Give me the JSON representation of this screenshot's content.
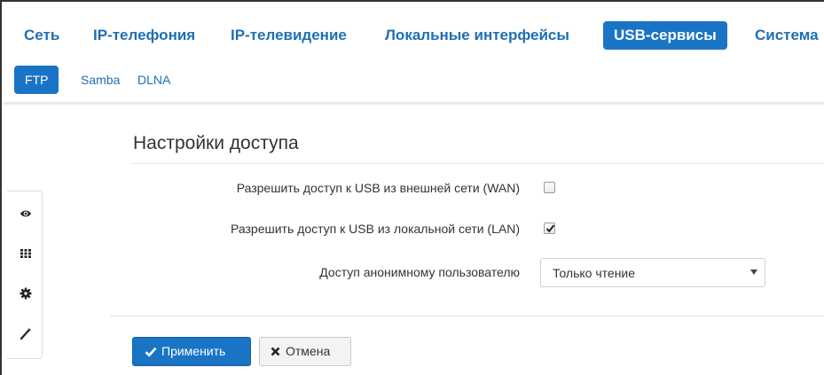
{
  "top_nav": {
    "items": [
      {
        "label": "Сеть"
      },
      {
        "label": "IP-телефония"
      },
      {
        "label": "IP-телевидение"
      },
      {
        "label": "Локальные интерфейсы"
      },
      {
        "label": "USB-сервисы",
        "active": true
      },
      {
        "label": "Система"
      }
    ]
  },
  "sub_nav": {
    "items": [
      {
        "label": "FTP",
        "active": true
      },
      {
        "label": "Samba"
      },
      {
        "label": "DLNA"
      }
    ]
  },
  "side_toolbar": {
    "icons": [
      "eye-icon",
      "grid-icon",
      "gear-icon",
      "magic-wand-icon"
    ]
  },
  "section": {
    "title": "Настройки доступа"
  },
  "form": {
    "wan_access": {
      "label": "Разрешить доступ к USB из внешней сети (WAN)",
      "checked": false
    },
    "lan_access": {
      "label": "Разрешить доступ к USB из локальной сети (LAN)",
      "checked": true
    },
    "anonymous_access": {
      "label": "Доступ анонимному пользователю",
      "value": "Только чтение"
    }
  },
  "actions": {
    "apply_label": "Применить",
    "cancel_label": "Отмена"
  },
  "colors": {
    "accent": "#1a74c6",
    "link": "#1f6fb2",
    "text": "#333333"
  }
}
